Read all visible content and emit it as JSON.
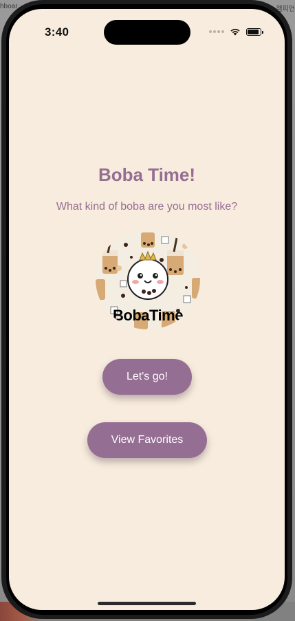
{
  "host": {
    "tab_left": "hboar",
    "tab_right": "챔피언"
  },
  "status_bar": {
    "time": "3:40",
    "icons": [
      "cellular-dots-icon",
      "wifi-icon",
      "battery-icon"
    ]
  },
  "app": {
    "title": "Boba Time!",
    "subtitle": "What kind of boba are you most like?",
    "logo_text": "BobaTime",
    "buttons": {
      "start": "Let's go!",
      "favorites": "View Favorites"
    }
  },
  "colors": {
    "background": "#f7ecdd",
    "accent": "#956e93",
    "button_text": "#ffffff"
  }
}
